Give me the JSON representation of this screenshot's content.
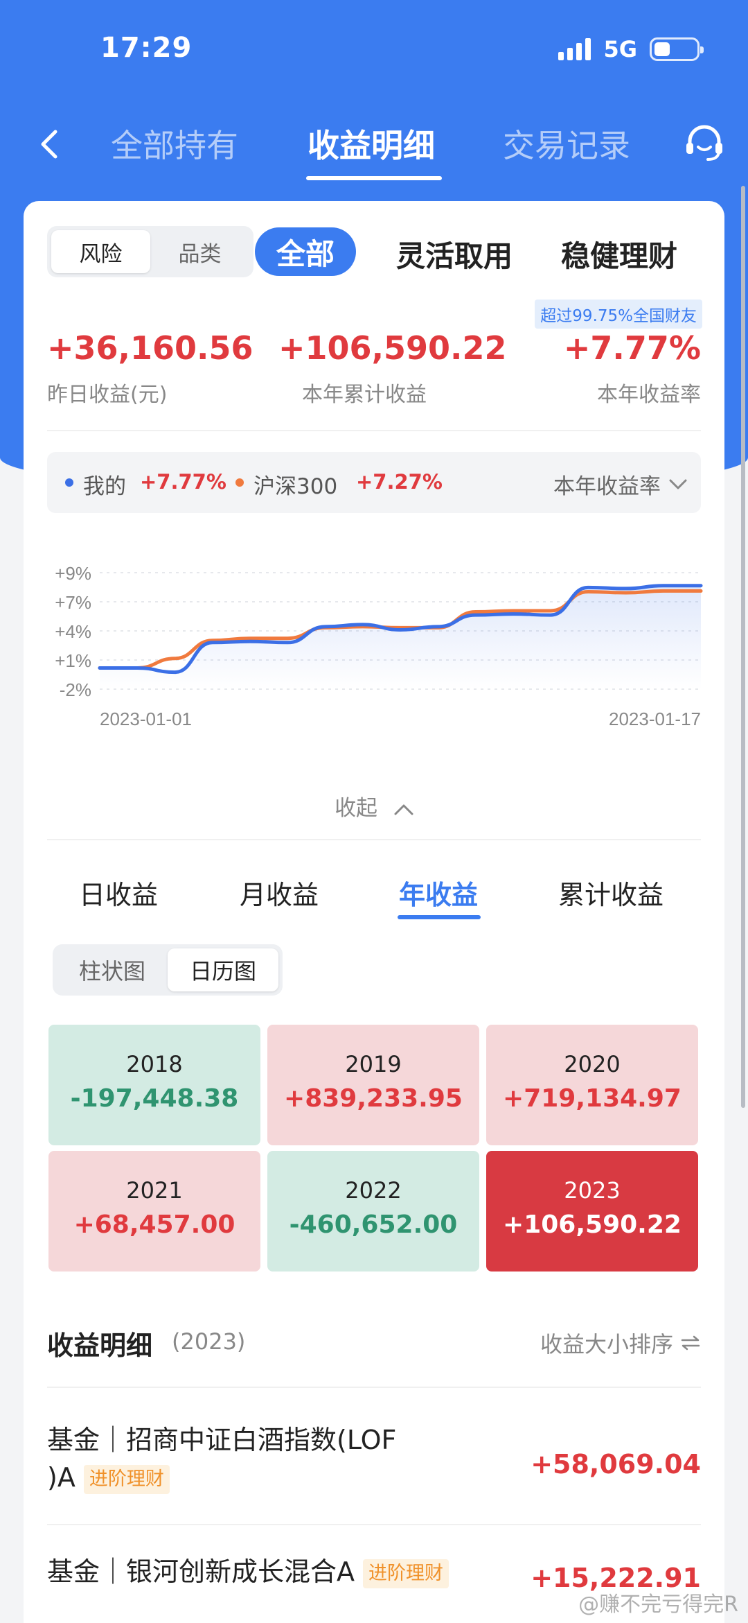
{
  "status_bar": {
    "time": "17:29",
    "network": "5G"
  },
  "nav": {
    "tabs": [
      {
        "label": "全部持有"
      },
      {
        "label": "收益明细"
      },
      {
        "label": "交易记录"
      }
    ]
  },
  "filters": {
    "segment": [
      "风险",
      "品类"
    ],
    "categories": [
      "全部",
      "灵活取用",
      "稳健理财"
    ]
  },
  "badge": "超过99.75%全国财友",
  "stats": [
    {
      "value": "+36,160.56",
      "label": "昨日收益(元)"
    },
    {
      "value": "+106,590.22",
      "label": "本年累计收益"
    },
    {
      "value": "+7.77%",
      "label": "本年收益率"
    }
  ],
  "legend": {
    "mine_label": "我的",
    "mine_value": "+7.77%",
    "bench_label": "沪深300",
    "bench_value": "+7.27%",
    "selector": "本年收益率"
  },
  "colors": {
    "mine": "#3b6fe6",
    "bench": "#f07a3e",
    "gain": "#e03a3e",
    "loss": "#2f9470",
    "accent": "#3b7cf0"
  },
  "chart_data": {
    "type": "line",
    "y_ticks": [
      "+9%",
      "+7%",
      "+4%",
      "+1%",
      "-2%"
    ],
    "ylim": [
      -2,
      9
    ],
    "x_labels": [
      "2023-01-01",
      "2023-01-17"
    ],
    "x": [
      1,
      2,
      3,
      4,
      5,
      6,
      7,
      8,
      9,
      10,
      11,
      12,
      13,
      14,
      15,
      16,
      17
    ],
    "series": [
      {
        "name": "我的",
        "values": [
          0.0,
          0.0,
          -0.4,
          2.4,
          2.5,
          2.4,
          3.9,
          4.1,
          3.6,
          3.9,
          5.0,
          5.1,
          5.0,
          7.6,
          7.5,
          7.77,
          7.77
        ]
      },
      {
        "name": "沪深300",
        "values": [
          0.0,
          0.0,
          0.9,
          2.6,
          2.8,
          2.8,
          3.8,
          3.9,
          3.8,
          3.8,
          5.3,
          5.4,
          5.4,
          7.2,
          7.1,
          7.27,
          7.27
        ]
      }
    ]
  },
  "collapse_label": "收起",
  "period_tabs": [
    "日收益",
    "月收益",
    "年收益",
    "累计收益"
  ],
  "view_toggle": [
    "柱状图",
    "日历图"
  ],
  "yearly": [
    {
      "year": "2018",
      "amount": "-197,448.38",
      "kind": "loss"
    },
    {
      "year": "2019",
      "amount": "+839,233.95",
      "kind": "gain"
    },
    {
      "year": "2020",
      "amount": "+719,134.97",
      "kind": "gain"
    },
    {
      "year": "2021",
      "amount": "+68,457.00",
      "kind": "gain"
    },
    {
      "year": "2022",
      "amount": "-460,652.00",
      "kind": "loss"
    },
    {
      "year": "2023",
      "amount": "+106,590.22",
      "kind": "current"
    }
  ],
  "detail": {
    "title": "收益明细",
    "year": "(2023)",
    "sort_label": "收益大小排序",
    "rows": [
      {
        "line1": "基金｜招商中证白酒指数(LOF",
        "line2": ")A",
        "tag": "进阶理财",
        "amount": "+58,069.04"
      },
      {
        "line1": "基金｜银河创新成长混合A",
        "tag": "进阶理财",
        "amount": "+15,222.91"
      }
    ]
  },
  "watermark": "@赚不完亏得完R"
}
